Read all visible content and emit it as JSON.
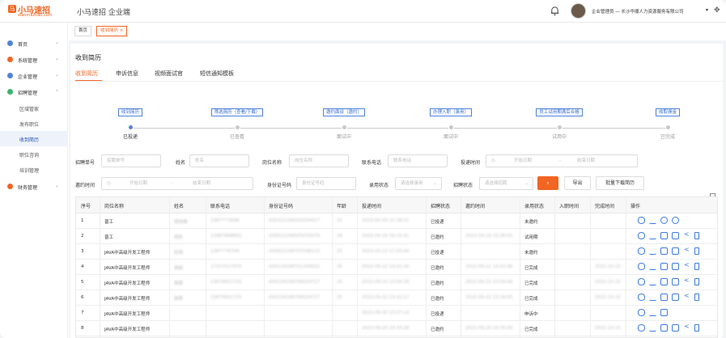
{
  "header": {
    "logo_main": "小马速招",
    "logo_sub": "xiaomazhao.com",
    "logo_mark": "马",
    "app_title": "小马速招 企业端",
    "user_text": "企业管理员 — 长沙华顺人力资源服务有限公司",
    "caret": "▾",
    "move_glyph": "✥",
    "accent_color": "#f26522"
  },
  "sidebar": {
    "items": [
      {
        "label": "首页",
        "color": "#4f83d9"
      },
      {
        "label": "系统管理",
        "color": "#f26522"
      },
      {
        "label": "企业管理",
        "color": "#4f83d9"
      },
      {
        "label": "招聘管理",
        "color": "#3bb36a"
      }
    ],
    "subitems": [
      "区域管家",
      "发布职位",
      "收到简历",
      "职位咨询",
      "培训管理"
    ],
    "last_item": {
      "label": "财务管理",
      "color": "#f26522"
    },
    "chevron": "⌄"
  },
  "tags": {
    "home": "首页",
    "current": "收到简历 ×"
  },
  "page": {
    "title": "收到简历",
    "tabs": [
      "收到简历",
      "申诉信息",
      "视频面试官",
      "短信通知模板"
    ]
  },
  "steps": [
    {
      "box": "收到简历",
      "label": "已投递",
      "active": true
    },
    {
      "box": "筛选简历（查看/下载）",
      "label": "已查看",
      "active": false
    },
    {
      "box": "邀约面谈（邀约）",
      "label": "面试中",
      "active": false
    },
    {
      "box": "办理入职（录用）",
      "label": "面试中",
      "active": false
    },
    {
      "box": "员工试用期满后合格",
      "label": "试用中",
      "active": false
    },
    {
      "box": "收取佣金",
      "label": "已完成",
      "active": false
    }
  ],
  "filters": {
    "recruit_no": {
      "label": "招聘单号",
      "placeholder": "招聘单号"
    },
    "name": {
      "label": "姓名",
      "placeholder": "姓名"
    },
    "position": {
      "label": "岗位名称",
      "placeholder": "岗位名称"
    },
    "phone": {
      "label": "联系电话",
      "placeholder": "联系电话"
    },
    "deliver_time": {
      "label": "投递时间",
      "start": "开始日期",
      "end": "结束日期",
      "sep": "-"
    },
    "invite_time": {
      "label": "邀约时间",
      "start": "开始日期",
      "end": "结束日期",
      "sep": "-"
    },
    "id_no": {
      "label": "身份证号码",
      "placeholder": "身份证号码"
    },
    "hire_status": {
      "label": "录用状态",
      "placeholder": "请选择录用"
    },
    "recruit_status": {
      "label": "招聘状态",
      "placeholder": "请选择招聘"
    },
    "search_icon": "⌕",
    "export_label": "导出",
    "batch_label": "批量下载简历",
    "clock_icon": "◷",
    "arrow": "⌄"
  },
  "table": {
    "headers": [
      "序号",
      "岗位名称",
      "姓名",
      "联系电话",
      "身份证号码",
      "年龄",
      "投递时间",
      "招聘状态",
      "邀约时间",
      "录用状态",
      "入职时间",
      "完成时间",
      "操作"
    ],
    "rows": [
      {
        "no": "1",
        "pos": "普工",
        "name": "周晓峰",
        "phone": "138****2698",
        "id": "430321199203204417",
        "age": "31",
        "time": "2023-05-09 22:28:21",
        "status": "已投递",
        "invite": "",
        "hire": "未邀约",
        "entry": "",
        "done": "",
        "ops": 4
      },
      {
        "no": "2",
        "pos": "普工",
        "name": "周凯",
        "phone": "13467868891",
        "id": "430521199505070079",
        "age": "28",
        "time": "2023-04-16 16:15:41",
        "status": "已邀约",
        "invite": "2023-04-19 15:30:55",
        "hire": "试用期",
        "entry": "",
        "done": "",
        "ops": 6
      },
      {
        "no": "3",
        "pos": "JAVA中高级开发工程师",
        "name": "彭翔",
        "phone": "138****6799",
        "id": "430621199707038123",
        "age": "25",
        "time": "2023-03-13 17:50:44",
        "status": "已投递",
        "invite": "",
        "hire": "未邀约",
        "entry": "",
        "done": "",
        "ops": 6
      },
      {
        "no": "4",
        "pos": "JAVA中高级开发工程师",
        "name": "谢斌",
        "phone": "17371517970",
        "id": "430124198701204022",
        "age": "35",
        "time": "2022-09-22 14:01:16",
        "status": "已邀约",
        "invite": "2022-09-22 14:02:46",
        "hire": "已完成",
        "entry": "",
        "done": "2022-10-15",
        "ops": 6
      },
      {
        "no": "5",
        "pos": "JAVA中高级开发工程师",
        "name": "黎果",
        "phone": "13679921725",
        "id": "430124199706024717",
        "age": "25",
        "time": "2022-09-22 13:54:18",
        "status": "已邀约",
        "invite": "2022-09-22 13:54:46",
        "hire": "已完成",
        "entry": "",
        "done": "2022-10-15",
        "ops": 6
      },
      {
        "no": "6",
        "pos": "JAVA中高级开发工程师",
        "name": "黎果",
        "phone": "13679921725",
        "id": "430124199706024717",
        "age": "25",
        "time": "2022-09-22 13:32:17",
        "status": "已邀约",
        "invite": "2022-09-22 13:34:05",
        "hire": "已完成",
        "entry": "",
        "done": "2022-10-15",
        "ops": 6
      },
      {
        "no": "7",
        "pos": "JAVA中高级开发工程师",
        "name": "",
        "phone": "",
        "id": "",
        "age": "",
        "time": "2022-09-20 15:07:14",
        "status": "已投递",
        "invite": "",
        "hire": "申诉中",
        "entry": "",
        "done": "",
        "ops": 3
      },
      {
        "no": "8",
        "pos": "JAVA中高级开发工程师",
        "name": "",
        "phone": "",
        "id": "",
        "age": "",
        "time": "2022-09-20 14:33:28",
        "status": "已邀约",
        "invite": "2022-09-20 14:35:09",
        "hire": "已完成",
        "entry": "",
        "done": "2022-10-15",
        "ops": 6
      },
      {
        "no": "9",
        "pos": "JAVA中高级开发工程师",
        "name": "",
        "phone": "",
        "id": "",
        "age": "",
        "time": "2022-09-20 14:10:32",
        "status": "已邀约",
        "invite": "2022-09-20 14:12:26",
        "hire": "已完成",
        "entry": "",
        "done": "2022-10-15",
        "ops": 6
      }
    ]
  }
}
